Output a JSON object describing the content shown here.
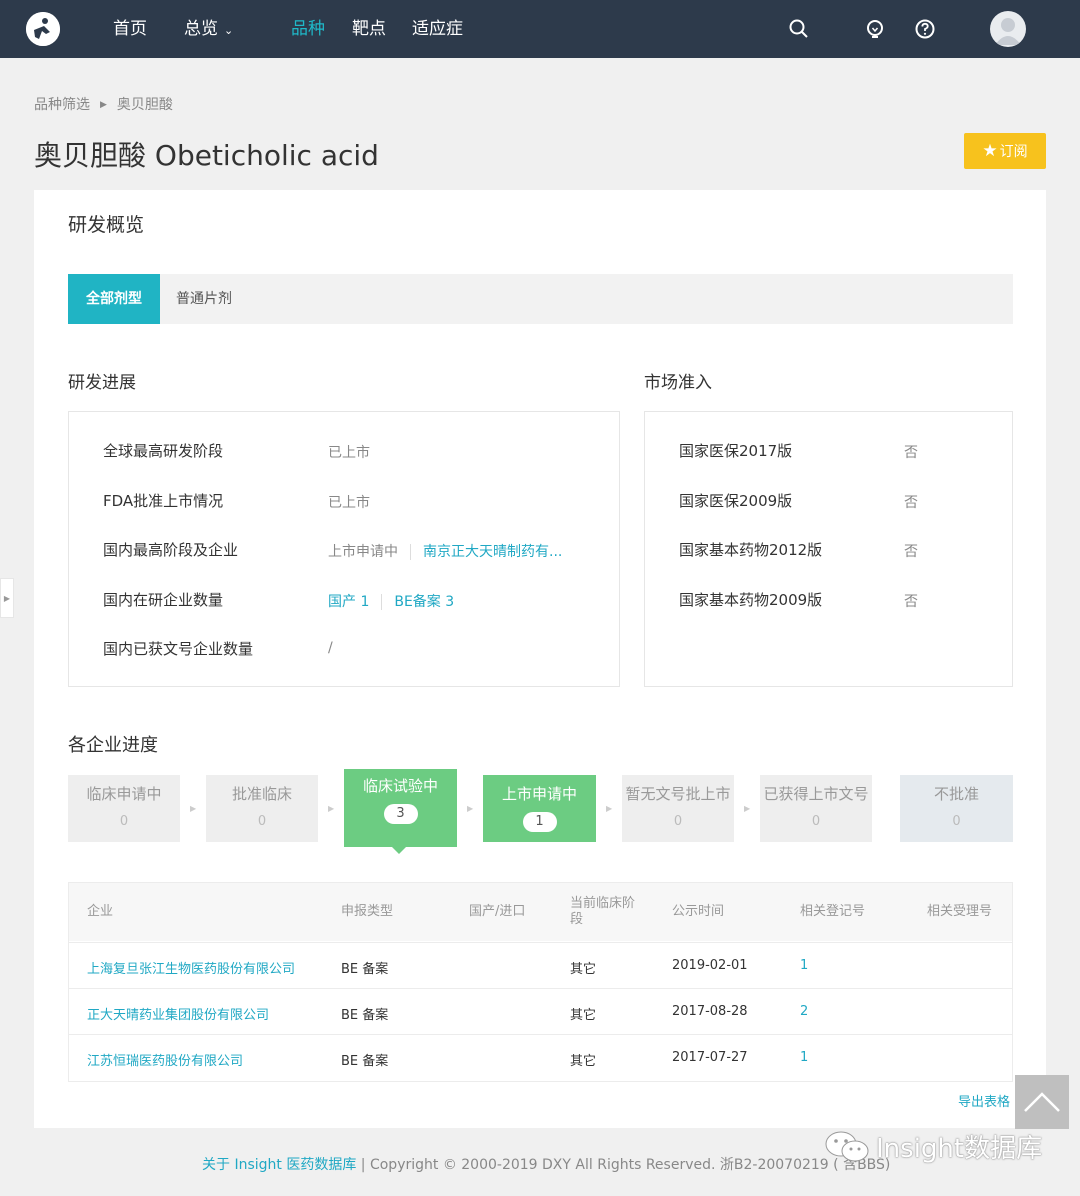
{
  "nav": {
    "items": [
      {
        "label": "首页"
      },
      {
        "label": "总览"
      },
      {
        "label": "品种"
      },
      {
        "label": "靶点"
      },
      {
        "label": "适应症"
      }
    ]
  },
  "breadcrumb": {
    "root": "品种筛选",
    "current": "奥贝胆酸"
  },
  "page": {
    "title": "奥贝胆酸 Obeticholic acid",
    "subscribe_label": "订阅"
  },
  "overview": {
    "title": "研发概览",
    "tabs": [
      {
        "label": "全部剂型"
      },
      {
        "label": "普通片剂"
      }
    ]
  },
  "progress": {
    "title": "研发进展",
    "rows": [
      {
        "label": "全球最高研发阶段",
        "value": "已上市"
      },
      {
        "label": "FDA批准上市情况",
        "value": "已上市"
      },
      {
        "label": "国内最高阶段及企业",
        "value": "上市申请中",
        "company": "南京正大天晴制药有..."
      },
      {
        "label": "国内在研企业数量",
        "domestic": "国产 1",
        "be": "BE备案 3"
      },
      {
        "label": "国内已获文号企业数量",
        "value": "/"
      }
    ]
  },
  "market": {
    "title": "市场准入",
    "rows": [
      {
        "label": "国家医保2017版",
        "value": "否"
      },
      {
        "label": "国家医保2009版",
        "value": "否"
      },
      {
        "label": "国家基本药物2012版",
        "value": "否"
      },
      {
        "label": "国家基本药物2009版",
        "value": "否"
      }
    ]
  },
  "enterprise": {
    "title": "各企业进度",
    "stages": [
      {
        "label": "临床申请中",
        "count": "0"
      },
      {
        "label": "批准临床",
        "count": "0"
      },
      {
        "label": "临床试验中",
        "count": "3"
      },
      {
        "label": "上市申请中",
        "count": "1"
      },
      {
        "label": "暂无文号批上市",
        "count": "0"
      },
      {
        "label": "已获得上市文号",
        "count": "0"
      },
      {
        "label": "不批准",
        "count": "0"
      }
    ],
    "columns": [
      "企业",
      "申报类型",
      "国产/进口",
      "当前临床阶段",
      "公示时间",
      "相关登记号",
      "相关受理号"
    ],
    "rows": [
      {
        "company": "上海复旦张江生物医药股份有限公司",
        "type": "BE 备案",
        "origin": "",
        "stage": "其它",
        "date": "2019-02-01",
        "reg": "1",
        "accept": ""
      },
      {
        "company": "正大天晴药业集团股份有限公司",
        "type": "BE 备案",
        "origin": "",
        "stage": "其它",
        "date": "2017-08-28",
        "reg": "2",
        "accept": ""
      },
      {
        "company": "江苏恒瑞医药股份有限公司",
        "type": "BE 备案",
        "origin": "",
        "stage": "其它",
        "date": "2017-07-27",
        "reg": "1",
        "accept": ""
      }
    ],
    "export_label": "导出表格"
  },
  "footer": {
    "about": "关于 Insight 医药数据库",
    "copyright": "| Copyright © 2000-2019 DXY All Rights Reserved. 浙B2-20070219 ( 含BBS)"
  },
  "watermark": {
    "text": "Insight数据库"
  },
  "colors": {
    "accent": "#20b4c4",
    "nav_bg": "#2d3a4b",
    "stage_green": "#6ccc82",
    "subscribe": "#f7c21d"
  }
}
